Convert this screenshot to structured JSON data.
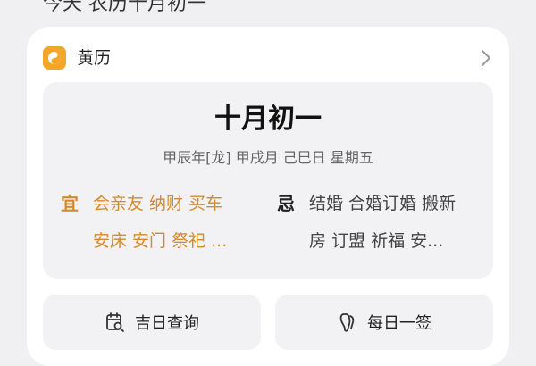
{
  "top_bar": {
    "text": "今天 农历十月初一"
  },
  "card": {
    "app_title": "黄历",
    "lunar_date": "十月初一",
    "ganzhi": "甲辰年[龙]  甲戌月 己巳日 星期五",
    "yi": {
      "mark": "宜",
      "line1": "会亲友 纳财 买车",
      "line2": "安床 安门 祭祀 ..."
    },
    "ji": {
      "mark": "忌",
      "line1": "结婚 合婚订婚 搬新",
      "line2": "房 订盟 祈福 安..."
    },
    "buttons": {
      "auspicious_day": "吉日查询",
      "daily_fortune": "每日一签"
    }
  },
  "colors": {
    "accent": "#d48a2c",
    "app_icon": "#f4a62a",
    "card_bg": "#ffffff",
    "panel_bg": "#f2f2f4"
  },
  "icons": {
    "app": "yin-yang-icon",
    "header": "chevron-right-icon",
    "auspicious_day": "calendar-search-icon",
    "daily_fortune": "fortune-stick-icon"
  }
}
